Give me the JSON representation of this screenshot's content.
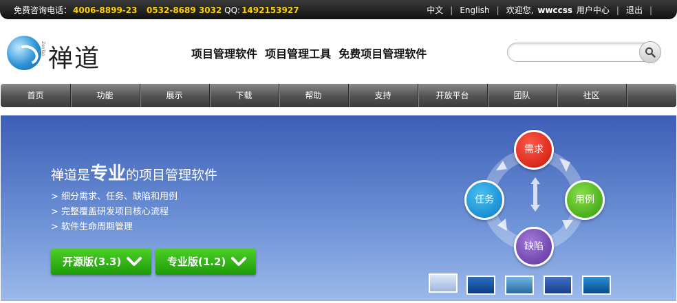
{
  "topbar": {
    "contact_label": "免费咨询电话：",
    "phone1": "4006-8899-23",
    "phone2": "0532-8689 3032",
    "qq_label": "QQ:",
    "qq": "1492153927",
    "lang_zh": "中文",
    "lang_en": "English",
    "welcome": "欢迎您,",
    "username": "wwccss",
    "user_center": "用户中心",
    "logout": "退出"
  },
  "logo": {
    "brand": "禅道",
    "pinyin": "ZenTao"
  },
  "header": {
    "slogan": "项目管理软件  项目管理工具  免费项目管理软件"
  },
  "search": {
    "placeholder": ""
  },
  "nav": {
    "items": [
      {
        "label": "首页"
      },
      {
        "label": "功能"
      },
      {
        "label": "展示"
      },
      {
        "label": "下载"
      },
      {
        "label": "帮助"
      },
      {
        "label": "支持"
      },
      {
        "label": "开放平台"
      },
      {
        "label": "团队"
      },
      {
        "label": "社区"
      }
    ]
  },
  "banner": {
    "headline_pre": "禅道是",
    "headline_big": "专业",
    "headline_post": "的项目管理软件",
    "features": [
      "> 细分需求、任务、缺陷和用例",
      "> 完整覆盖研发项目核心流程",
      "> 软件生命周期管理"
    ],
    "btn_open": "开源版(3.3)",
    "btn_pro": "专业版(1.2)",
    "cycle": {
      "need": "需求",
      "case": "用例",
      "bug": "缺陷",
      "task": "任务"
    }
  },
  "colors": {
    "accent_yellow": "#ffd200",
    "download_green": "#2fb312",
    "banner_blue": "#3d5eb6"
  }
}
